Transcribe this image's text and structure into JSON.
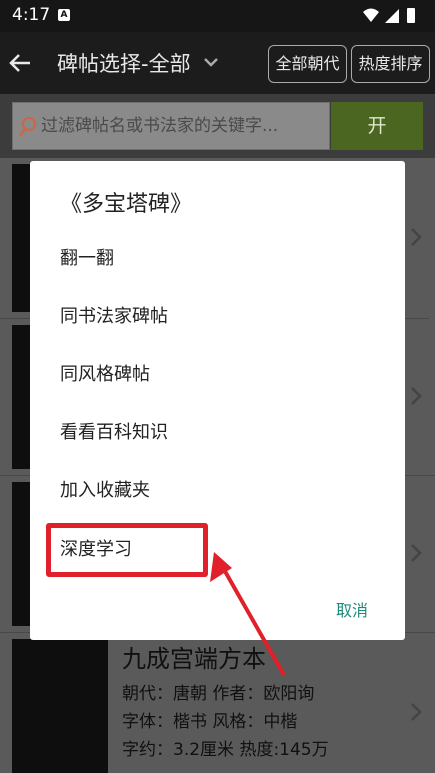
{
  "status": {
    "time": "4:17",
    "app_indicator": "A",
    "icons": [
      "wifi-icon",
      "signal-icon",
      "battery-icon"
    ]
  },
  "header": {
    "title": "碑帖选择-全部",
    "dynasty_button": "全部朝代",
    "sort_button": "热度排序"
  },
  "search": {
    "placeholder": "过滤碑帖名或书法家的关键字...",
    "start_label": "开 始"
  },
  "list": [
    {
      "title": "九成宫端方本",
      "line1": "朝代：唐朝 作者：欧阳询",
      "line2": "字体：楷书 风格：中楷",
      "line3": "字约：3.2厘米 热度:145万"
    }
  ],
  "dialog": {
    "title": "《多宝塔碑》",
    "items": [
      "翻一翻",
      "同书法家碑帖",
      "同风格碑帖",
      "看看百科知识",
      "加入收藏夹",
      "深度学习"
    ],
    "cancel": "取消"
  },
  "colors": {
    "highlight": "#e0212b",
    "accent": "#1e8a7a",
    "start_button": "#4a6620"
  }
}
